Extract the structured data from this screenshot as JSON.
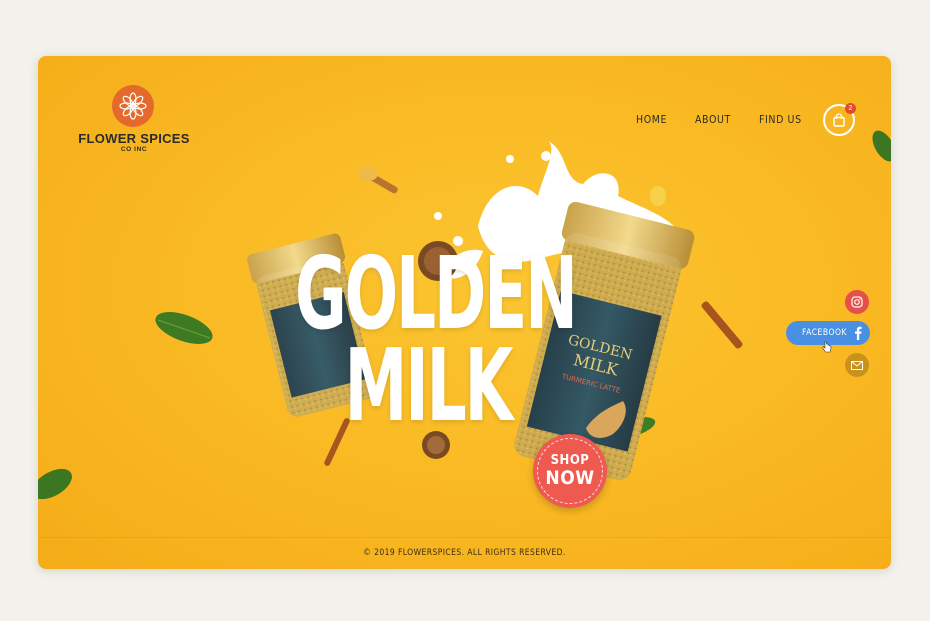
{
  "brand": {
    "name": "FLOWER SPICES",
    "sub": "CO INC",
    "accent": "#e36a2c"
  },
  "nav": {
    "items": [
      {
        "label": "HOME"
      },
      {
        "label": "ABOUT"
      },
      {
        "label": "FIND US"
      }
    ],
    "cart_icon": "shopping-bag-icon",
    "cart_count": "2"
  },
  "hero": {
    "headline_line1": "GOLDEN",
    "headline_line2": "MILK",
    "product_label_line1": "GOLDEN",
    "product_label_line2": "MILK",
    "product_label_line3": "TURMERIC LATTE",
    "cta_line1": "SHOP",
    "cta_line2": "NOW",
    "background_color": "#f9b822",
    "cta_color": "#ef5a50"
  },
  "social": {
    "instagram_icon": "instagram-icon",
    "facebook_label": "FACEBOOK",
    "facebook_icon": "facebook-icon",
    "email_icon": "mail-icon",
    "facebook_color": "#4a90e2",
    "instagram_color": "#e6504a",
    "email_color": "#c8921c"
  },
  "footer": {
    "copyright": "© 2019 FLOWERSPICES. ALL RIGHTS RESERVED."
  }
}
